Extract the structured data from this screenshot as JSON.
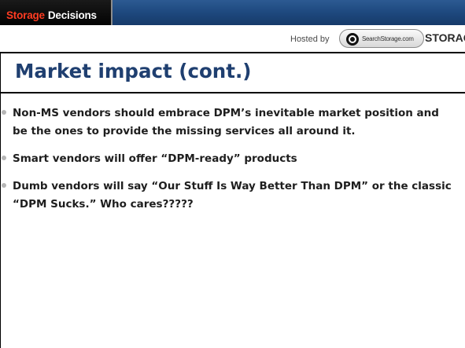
{
  "header": {
    "logo_word_1": "Storage",
    "logo_word_2": "Decisions",
    "hosted_by": "Hosted by",
    "sponsor_text": "SearchStorage.com",
    "brand": "STORAGE"
  },
  "slide": {
    "title": "Market impact (cont.)",
    "bullets": [
      "Non-MS vendors should embrace DPM’s inevitable market position and be the ones to provide the missing services all around it.",
      "Smart vendors will offer “DPM-ready” products",
      "Dumb vendors will say “Our Stuff Is Way Better Than DPM” or the classic “DPM Sucks.”  Who cares?????"
    ]
  },
  "colors": {
    "header_blue": "#1f4a80",
    "title_blue": "#1f3f70",
    "logo_accent": "#ff3c22"
  },
  "icons": [
    "sponsor-eye-icon",
    "bullet-dot-icon"
  ]
}
